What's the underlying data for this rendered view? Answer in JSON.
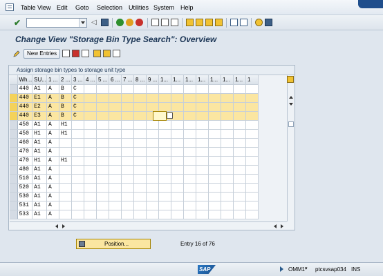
{
  "menu": [
    "Table View",
    "Edit",
    "Goto",
    "Selection",
    "Utilities",
    "System",
    "Help"
  ],
  "command_field": {
    "value": ""
  },
  "screen_title": "Change View \"Storage Bin Type Search\": Overview",
  "app_toolbar": {
    "new_entries": "New Entries"
  },
  "table": {
    "caption": "Assign storage bin types to storage unit type",
    "columns": [
      "Wh...",
      "SU...",
      "1 ...",
      "2 ...",
      "3 ...",
      "4 ...",
      "5 ...",
      "6 ...",
      "7 ...",
      "8 ...",
      "9 ...",
      "1...",
      "1...",
      "1...",
      "1...",
      "1...",
      "1...",
      "1...",
      "1"
    ],
    "rows": [
      [
        "440",
        "A1",
        "A",
        "B",
        "C"
      ],
      [
        "440",
        "E1",
        "A",
        "B",
        "C"
      ],
      [
        "440",
        "E2",
        "A",
        "B",
        "C"
      ],
      [
        "440",
        "E3",
        "A",
        "B",
        "C"
      ],
      [
        "450",
        "A1",
        "A",
        "H1",
        ""
      ],
      [
        "450",
        "H1",
        "A",
        "H1",
        ""
      ],
      [
        "460",
        "A1",
        "A",
        "",
        ""
      ],
      [
        "470",
        "A1",
        "A",
        "",
        ""
      ],
      [
        "470",
        "H1",
        "A",
        "H1",
        ""
      ],
      [
        "480",
        "A1",
        "A",
        "",
        ""
      ],
      [
        "510",
        "A1",
        "A",
        "",
        ""
      ],
      [
        "520",
        "A1",
        "A",
        "",
        ""
      ],
      [
        "530",
        "A1",
        "A",
        "",
        ""
      ],
      [
        "531",
        "A1",
        "A",
        "",
        ""
      ],
      [
        "533",
        "A1",
        "A",
        "",
        ""
      ]
    ],
    "highlighted_rows": [
      1,
      2,
      3
    ]
  },
  "position_button": "Position...",
  "entry_info": "Entry 16 of 76",
  "status": {
    "system": "OMM1",
    "server": "ptcsvsap034",
    "mode": "INS"
  },
  "colors": {
    "highlight": "#fbe6a1",
    "title": "#1b3555",
    "accent": "#1f4e8c"
  }
}
